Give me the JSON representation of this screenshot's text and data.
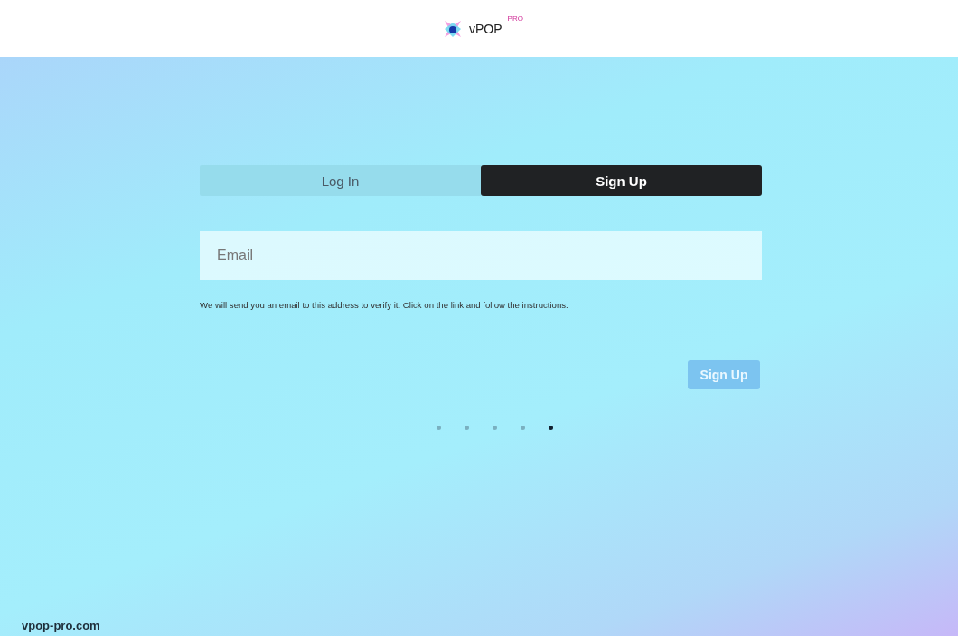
{
  "header": {
    "brand": "vPOP",
    "badge": "PRO"
  },
  "tabs": [
    {
      "label": "Log In",
      "selected": false
    },
    {
      "label": "Sign Up",
      "selected": true
    }
  ],
  "email_field": {
    "placeholder": "Email"
  },
  "hint": "We will send you an email to this address to verify it. Click on the link and follow the instructions.",
  "submit_button": {
    "label": "Sign Up",
    "disabled": true
  },
  "pager_dots": [
    {
      "selected": false
    },
    {
      "selected": false
    },
    {
      "selected": false
    },
    {
      "selected": false
    },
    {
      "selected": true
    }
  ],
  "footer": {
    "site": "vpop-pro.com"
  }
}
